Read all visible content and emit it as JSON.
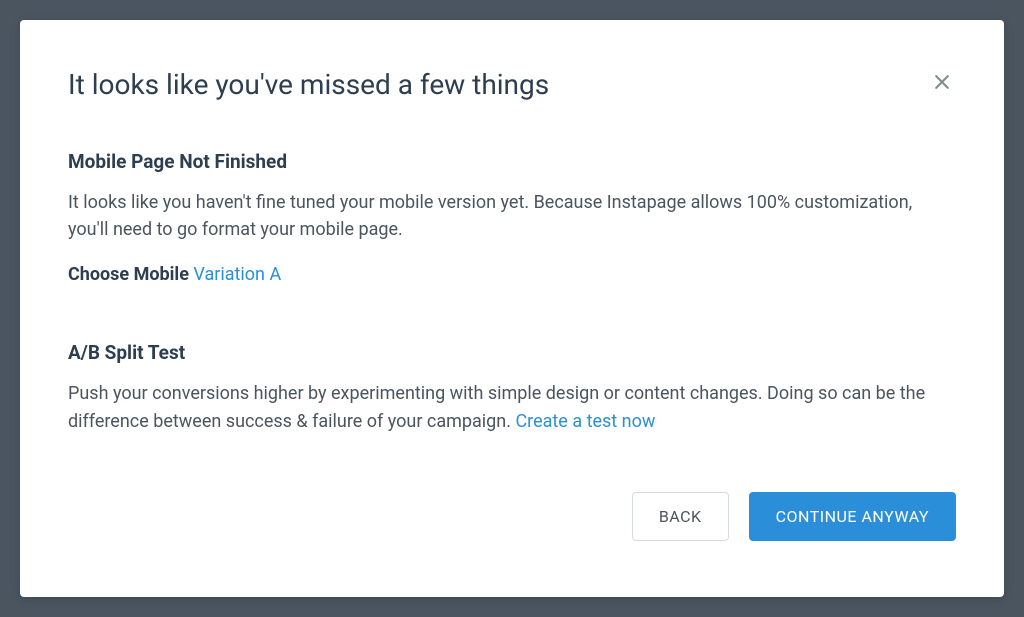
{
  "modal": {
    "title": "It looks like you've missed a few things",
    "sections": {
      "mobile": {
        "title": "Mobile Page Not Finished",
        "text": "It looks like you haven't fine tuned your mobile version yet. Because Instapage allows 100% customization, you'll need to go format your mobile page.",
        "footer_label": "Choose Mobile ",
        "footer_link": "Variation A"
      },
      "abtest": {
        "title": "A/B Split Test",
        "text": "Push your conversions higher by experimenting with simple design or content changes. Doing so can be the difference between success & failure of your campaign. ",
        "link": "Create a test now"
      }
    },
    "buttons": {
      "back": "BACK",
      "continue": "CONTINUE ANYWAY"
    }
  }
}
